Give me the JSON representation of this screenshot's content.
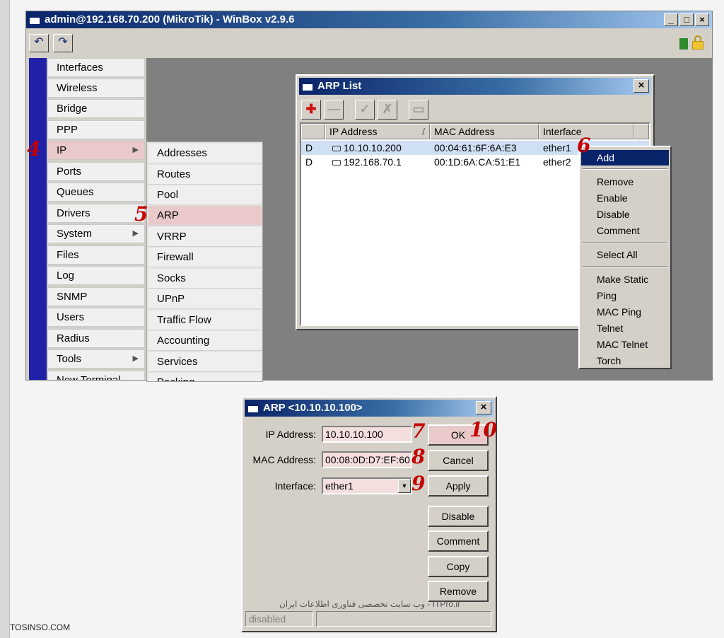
{
  "winbox": {
    "title": "admin@192.168.70.200 (MikroTik) - WinBox v2.9.6",
    "window_buttons": [
      "_",
      "□",
      "×"
    ],
    "toolbar": {
      "undo_icon": "undo-icon",
      "redo_icon": "redo-icon"
    }
  },
  "side_menu": {
    "items": [
      {
        "label": "Interfaces"
      },
      {
        "label": "Wireless"
      },
      {
        "label": "Bridge"
      },
      {
        "label": "PPP"
      },
      {
        "label": "IP",
        "has_submenu": true,
        "active": true
      },
      {
        "label": "Ports"
      },
      {
        "label": "Queues"
      },
      {
        "label": "Drivers"
      },
      {
        "label": "System",
        "has_submenu": true
      },
      {
        "label": "Files"
      },
      {
        "label": "Log"
      },
      {
        "label": "SNMP"
      },
      {
        "label": "Users"
      },
      {
        "label": "Radius"
      },
      {
        "label": "Tools",
        "has_submenu": true
      },
      {
        "label": "New Terminal"
      }
    ]
  },
  "ip_submenu": {
    "items": [
      {
        "label": "Addresses"
      },
      {
        "label": "Routes"
      },
      {
        "label": "Pool"
      },
      {
        "label": "ARP",
        "active": true
      },
      {
        "label": "VRRP"
      },
      {
        "label": "Firewall"
      },
      {
        "label": "Socks"
      },
      {
        "label": "UPnP"
      },
      {
        "label": "Traffic Flow"
      },
      {
        "label": "Accounting"
      },
      {
        "label": "Services"
      },
      {
        "label": "Packing"
      }
    ]
  },
  "arp_list": {
    "title": "ARP List",
    "close_label": "×",
    "columns": [
      "IP Address",
      "MAC Address",
      "Interface"
    ],
    "rows": [
      {
        "flag": "D",
        "ip": "10.10.10.200",
        "mac": "00:04:61:6F:6A:E3",
        "interface": "ether1",
        "selected": true
      },
      {
        "flag": "D",
        "ip": "192.168.70.1",
        "mac": "00:1D:6A:CA:51:E1",
        "interface": "ether2",
        "selected": false
      }
    ]
  },
  "context_menu": {
    "items": [
      "Add",
      "Remove",
      "Enable",
      "Disable",
      "Comment",
      "Select All",
      "Make Static",
      "Ping",
      "MAC Ping",
      "Telnet",
      "MAC Telnet",
      "Torch"
    ]
  },
  "arp_dialog": {
    "title": "ARP <10.10.10.100>",
    "close_label": "×",
    "ip_label": "IP Address:",
    "ip_value": "10.10.10.100",
    "mac_label": "MAC Address:",
    "mac_value": "00:08:0D:D7:EF:60",
    "interface_label": "Interface:",
    "interface_value": "ether1",
    "buttons": [
      "OK",
      "Cancel",
      "Apply",
      "Disable",
      "Comment",
      "Copy",
      "Remove"
    ],
    "status": "disabled",
    "footer_text": "ITPro.ir - وب سایت تخصصی فناوری اطلاعات ایران"
  },
  "step_numbers": [
    "4",
    "5",
    "6",
    "7",
    "8",
    "9",
    "10"
  ],
  "watermark": "TOSINSO.COM",
  "colors": {
    "title_bar": "#0a246a",
    "highlight": "#e9c9c9",
    "step_number": "#c40000",
    "menu_strip": "#2020a8"
  }
}
